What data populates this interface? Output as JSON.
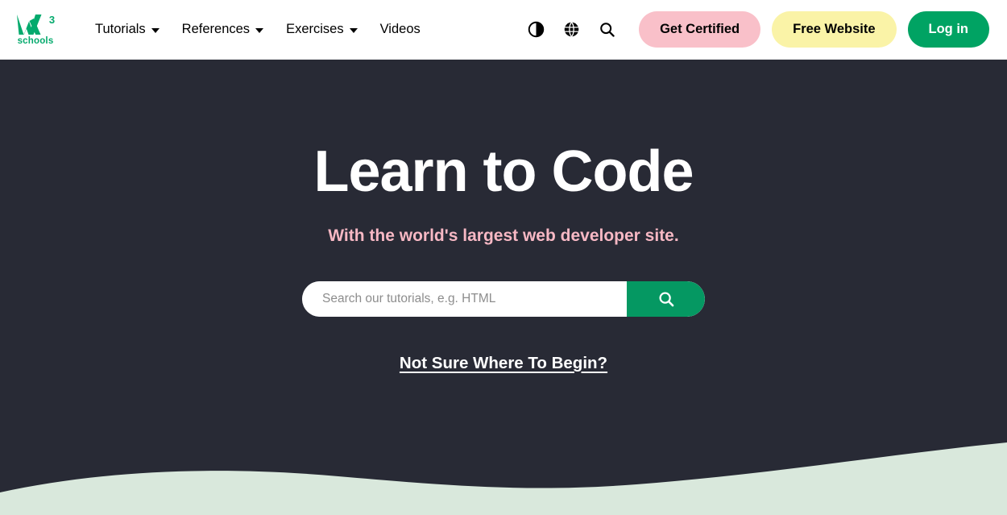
{
  "brand": {
    "name": "w3schools",
    "mark_letter": "W",
    "superscript": "3",
    "subtext": "schools",
    "color": "#04AA6D"
  },
  "navbar": {
    "links": [
      {
        "label": "Tutorials",
        "has_dropdown": true,
        "icon": "chevron-down-icon"
      },
      {
        "label": "References",
        "has_dropdown": true,
        "icon": "chevron-down-icon"
      },
      {
        "label": "Exercises",
        "has_dropdown": true,
        "icon": "chevron-down-icon"
      },
      {
        "label": "Videos",
        "has_dropdown": false,
        "icon": ""
      }
    ],
    "icons": [
      {
        "name": "dark-mode-toggle-icon",
        "title": "Toggle dark mode"
      },
      {
        "name": "globe-translate-icon",
        "title": "Change language"
      },
      {
        "name": "search-icon",
        "title": "Search"
      }
    ],
    "buttons": [
      {
        "label": "Get Certified",
        "style": "pink",
        "color": "#f9c0c9",
        "text_color": "#000000"
      },
      {
        "label": "Free Website",
        "style": "yellow",
        "color": "#faf3a7",
        "text_color": "#000000"
      },
      {
        "label": "Log in",
        "style": "green",
        "color": "#00a363",
        "text_color": "#ffffff"
      }
    ]
  },
  "hero": {
    "title": "Learn to Code",
    "subtitle": "With the world's largest web developer site.",
    "title_color": "#ffffff",
    "subtitle_color": "#f7b8c4",
    "background_color": "#282a35",
    "search": {
      "placeholder": "Search our tutorials, e.g. HTML",
      "value": "",
      "button_icon": "search-icon",
      "button_color": "#059862"
    },
    "begin_link": "Not Sure Where To Begin?"
  },
  "wave": {
    "color": "#d9e8dc"
  }
}
